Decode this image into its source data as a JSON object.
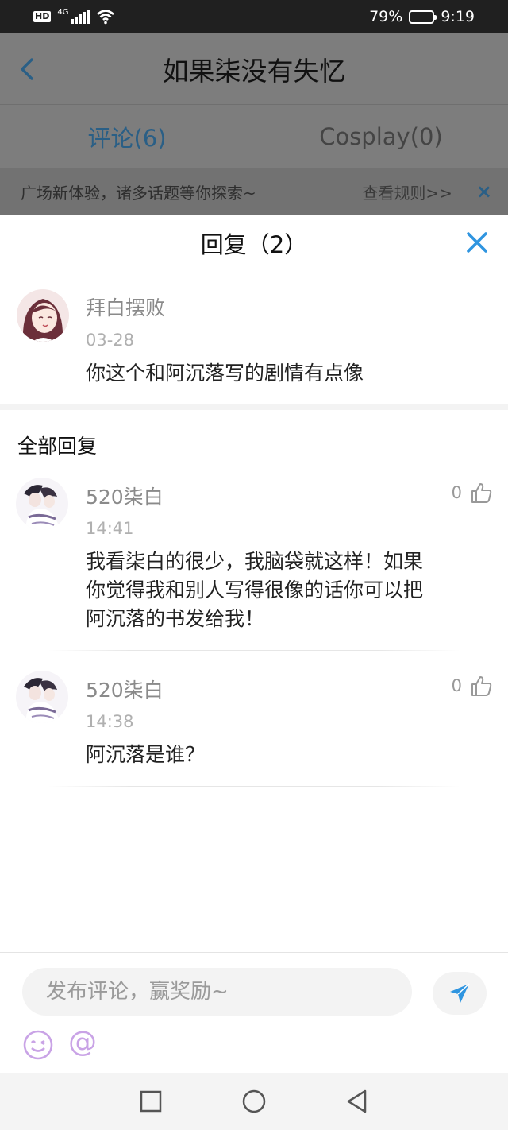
{
  "status_bar": {
    "hd": "HD",
    "network": "4G",
    "battery": "79%",
    "battery_level": 0.79,
    "time": "9:19"
  },
  "page": {
    "title": "如果柒没有失忆",
    "tabs": [
      {
        "label": "评论(6)",
        "active": true
      },
      {
        "label": "Cosplay(0)",
        "active": false
      }
    ],
    "banner": {
      "text": "广场新体验，诸多话题等你探索~",
      "link": "查看规则>>",
      "close": "×"
    }
  },
  "sheet": {
    "title": "回复（2）",
    "main_comment": {
      "name": "拜白摆败",
      "time": "03-28",
      "text": "你这个和阿沉落写的剧情有点像"
    },
    "section_title": "全部回复",
    "replies": [
      {
        "name": "520柒白",
        "time": "14:41",
        "text_lines": [
          "我看柒白的很少，我脑袋就这样！如果",
          "你觉得我和别人写得很像的话你可以把",
          "阿沉落的书发给我！"
        ],
        "likes": "0"
      },
      {
        "name": "520柒白",
        "time": "14:38",
        "text_lines": [
          "阿沉落是谁？"
        ],
        "likes": "0"
      }
    ]
  },
  "compose": {
    "placeholder": "发布评论，赢奖励~",
    "at_symbol": "@"
  },
  "colors": {
    "accent": "#2f95e0",
    "dim_overlay": "#7d7d7d",
    "emoji": "#c9a3e6"
  }
}
